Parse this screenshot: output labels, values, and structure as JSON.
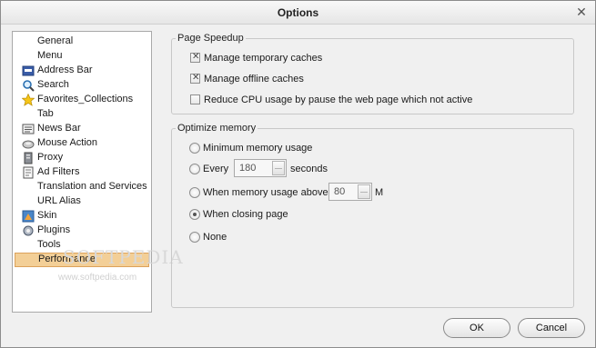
{
  "window": {
    "title": "Options",
    "close_glyph": "✕"
  },
  "sidebar": {
    "items": [
      {
        "label": "General",
        "icon": ""
      },
      {
        "label": "Menu",
        "icon": ""
      },
      {
        "label": "Address Bar",
        "icon": "address-bar-icon"
      },
      {
        "label": "Search",
        "icon": "search-icon"
      },
      {
        "label": "Favorites_Collections",
        "icon": "star-icon"
      },
      {
        "label": "Tab",
        "icon": ""
      },
      {
        "label": "News Bar",
        "icon": "news-icon"
      },
      {
        "label": "Mouse Action",
        "icon": "mouse-icon"
      },
      {
        "label": "Proxy",
        "icon": "proxy-icon"
      },
      {
        "label": "Ad Filters",
        "icon": "filter-icon"
      },
      {
        "label": "Translation and Services",
        "icon": ""
      },
      {
        "label": "URL Alias",
        "icon": ""
      },
      {
        "label": "Skin",
        "icon": "skin-icon"
      },
      {
        "label": "Plugins",
        "icon": "plugins-icon"
      },
      {
        "label": "Tools",
        "icon": ""
      },
      {
        "label": "Performance",
        "icon": "",
        "selected": true
      }
    ],
    "watermark": "SOFTPEDIA",
    "watermark_url": "www.softpedia.com"
  },
  "page_speedup": {
    "legend": "Page Speedup",
    "options": [
      {
        "label": "Manage temporary caches",
        "checked": true
      },
      {
        "label": "Manage offline caches",
        "checked": true
      },
      {
        "label": "Reduce CPU usage by pause the web page which not active",
        "checked": false
      }
    ]
  },
  "optimize_memory": {
    "legend": "Optimize memory",
    "minimum": "Minimum memory usage",
    "every": "Every",
    "every_value": "180",
    "every_unit": "seconds",
    "above": "When memory usage above",
    "above_value": "80",
    "above_unit": "M",
    "closing": "When closing page",
    "none": "None",
    "selected": "closing"
  },
  "buttons": {
    "ok": "OK",
    "cancel": "Cancel"
  },
  "colors": {
    "selection_bg": "#f3cf97",
    "selection_border": "#dca25b"
  }
}
